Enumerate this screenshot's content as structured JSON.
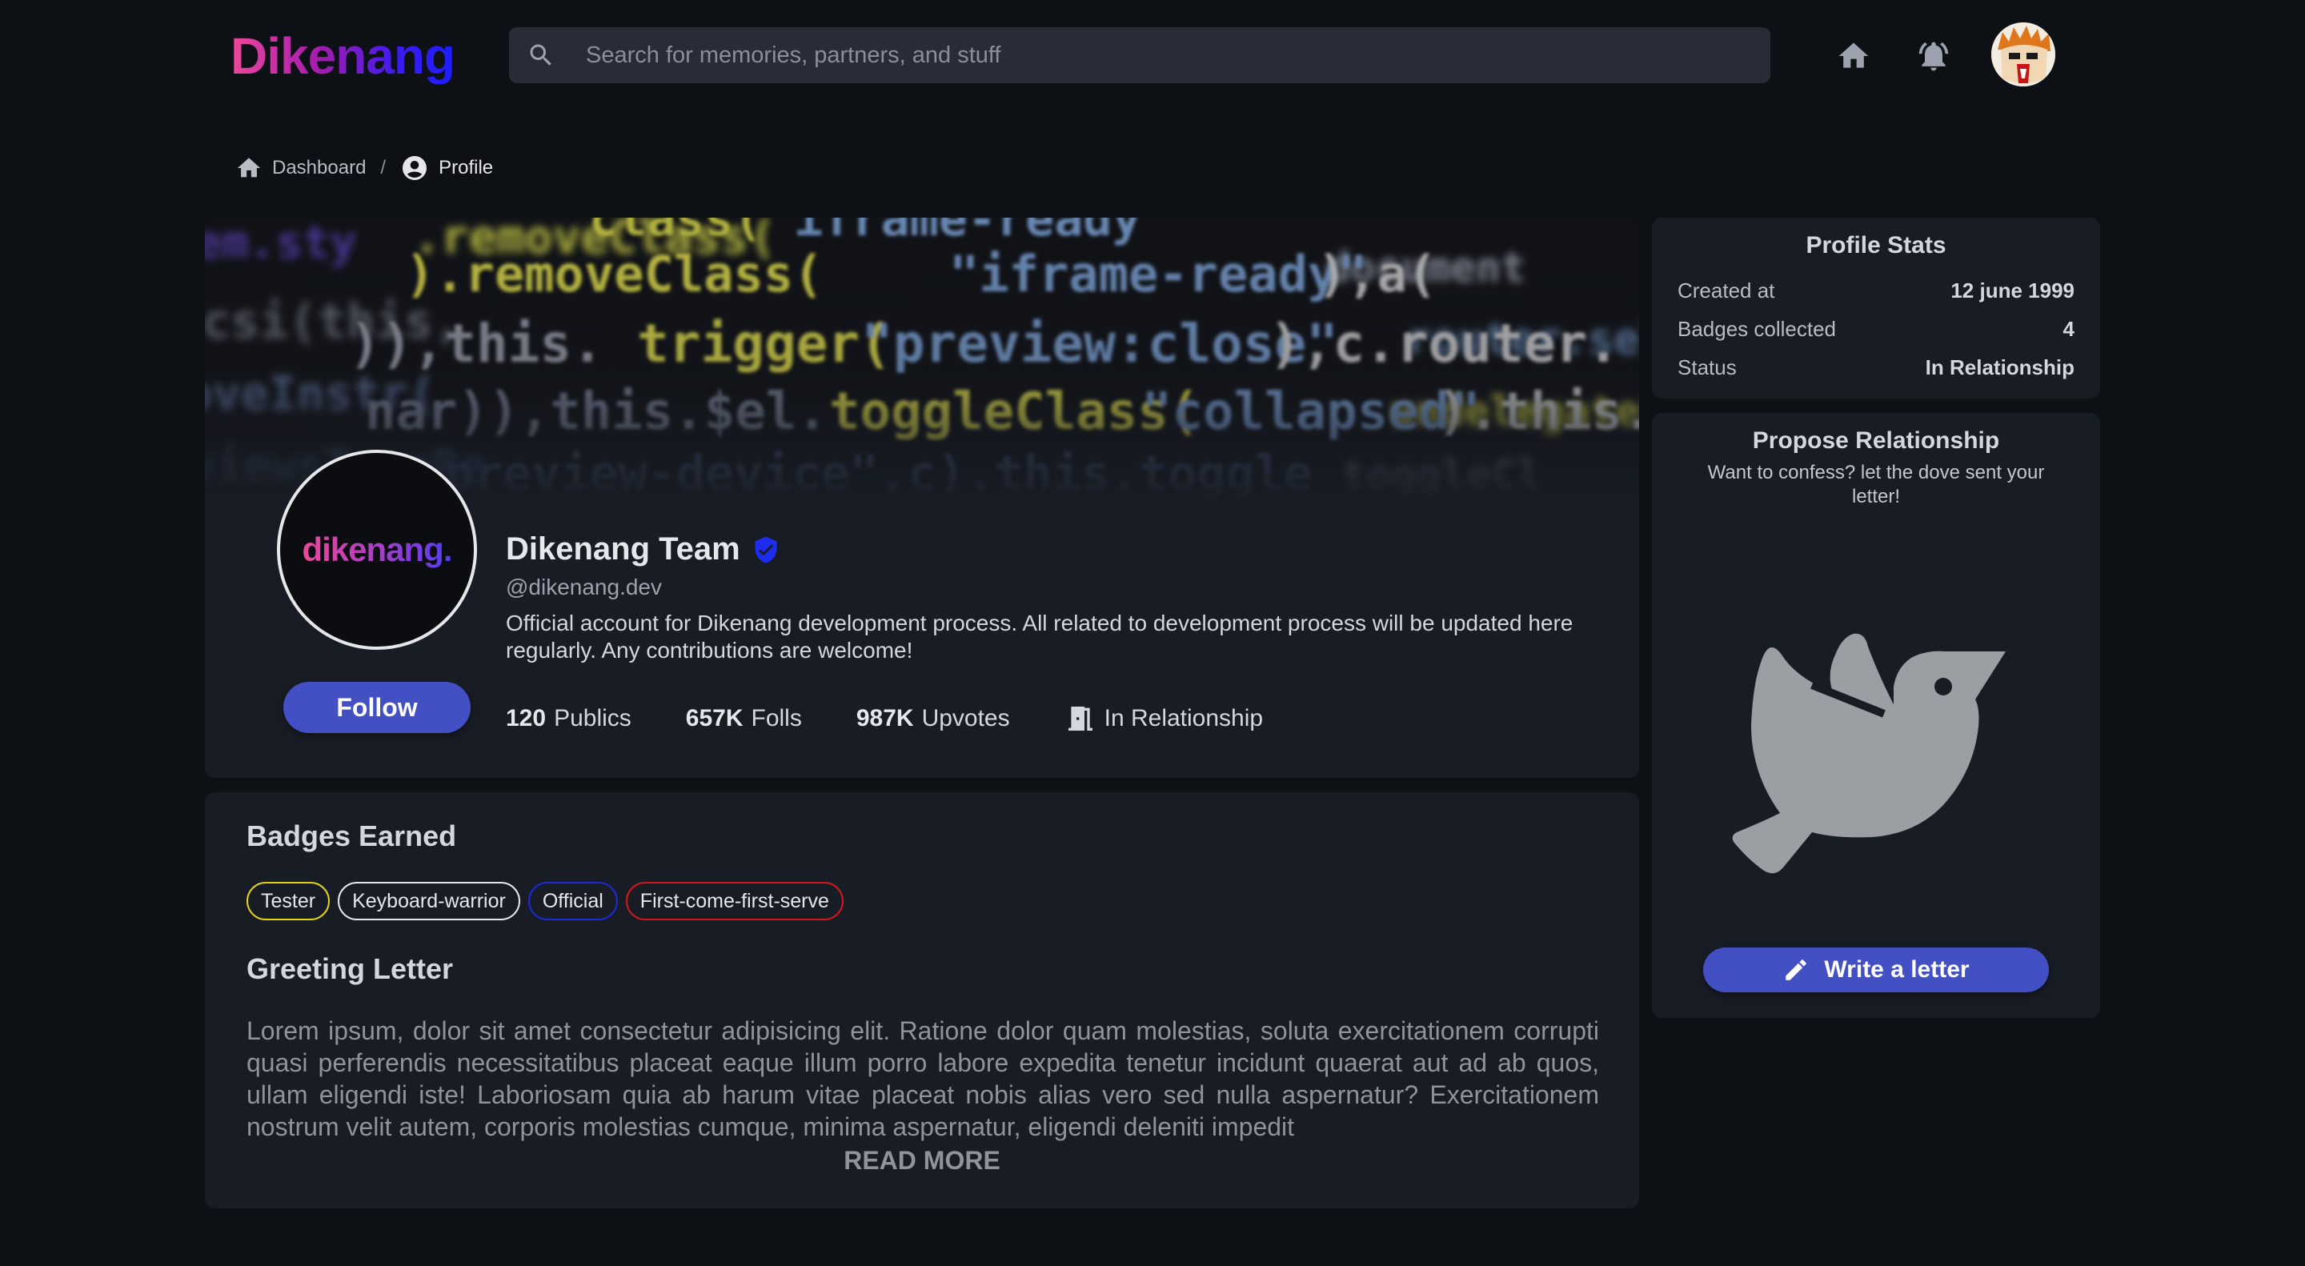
{
  "header": {
    "logo_text": "Dikenang",
    "search_placeholder": "Search for memories, partners, and stuff",
    "icons": [
      "home-icon",
      "bell-icon",
      "user-avatar"
    ]
  },
  "breadcrumb": {
    "items": [
      {
        "label": "Dashboard",
        "icon": "home-icon"
      },
      {
        "label": "Profile",
        "icon": "account-circle-icon"
      }
    ],
    "separator": "/"
  },
  "profile": {
    "avatar_text": "dikenang.",
    "name": "Dikenang Team",
    "verified_icon": "verified-badge-icon",
    "handle": "@dikenang.dev",
    "bio": "Official account for Dikenang development process. All related to development process will be updated here regularly. Any contributions are welcome!",
    "follow_label": "Follow",
    "stats": [
      {
        "value": "120",
        "label": "Publics"
      },
      {
        "value": "657K",
        "label": "Folls"
      },
      {
        "value": "987K",
        "label": "Upvotes"
      }
    ],
    "relationship_status": "In Relationship",
    "relationship_icon": "door-icon"
  },
  "badges_section": {
    "title": "Badges Earned",
    "badges": [
      {
        "label": "Tester",
        "color": "#e3d21b"
      },
      {
        "label": "Keyboard-warrior",
        "color": "#e5e7eb"
      },
      {
        "label": "Official",
        "color": "#1b2bd8"
      },
      {
        "label": "First-come-first-serve",
        "color": "#d21a1a"
      }
    ]
  },
  "greeting": {
    "title": "Greeting Letter",
    "body": "Lorem ipsum, dolor sit amet consectetur adipisicing elit. Ratione dolor quam molestias, soluta exercitationem corrupti quasi perferendis necessitatibus placeat eaque illum porro labore expedita tenetur incidunt quaerat aut ad ab quos, ullam eligendi iste! Laboriosam quia ab harum vitae placeat nobis alias vero sed nulla aspernatur? Exercitationem nostrum velit autem, corporis molestias cumque, minima aspernatur, eligendi deleniti impedit",
    "read_more": "READ MORE"
  },
  "profile_stats": {
    "title": "Profile Stats",
    "rows": [
      {
        "label": "Created at",
        "value": "12 june 1999"
      },
      {
        "label": "Badges collected",
        "value": "4"
      },
      {
        "label": "Status",
        "value": "In Relationship"
      }
    ]
  },
  "propose": {
    "title": "Propose Relationship",
    "subtitle": "Want to confess? let the dove sent your letter!",
    "illustration": "dove-icon",
    "button_label": "Write a letter",
    "button_icon": "pencil-icon"
  },
  "colors": {
    "accent": "#4250c4",
    "verified": "#1d2df0",
    "background": "#0d1014",
    "card": "#181c24"
  }
}
